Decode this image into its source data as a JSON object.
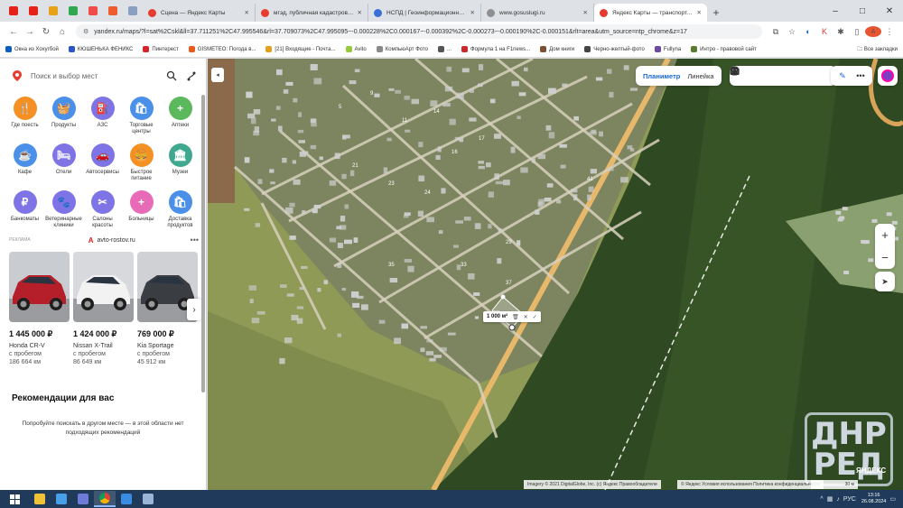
{
  "browser": {
    "pinned_tabs": [
      {
        "icon": "youtube-icon",
        "color": "#e62117"
      },
      {
        "icon": "youtube-icon",
        "color": "#e62117"
      },
      {
        "icon": "gmail-icon",
        "color": "#e6a117"
      },
      {
        "icon": "paw-icon",
        "color": "#2fa84f"
      },
      {
        "icon": "mail-icon",
        "color": "#f04a4a"
      },
      {
        "icon": "bookmark-icon",
        "color": "#ef5a2e"
      },
      {
        "icon": "page-icon",
        "color": "#8aa0c0"
      }
    ],
    "tabs": [
      {
        "title": "Сцена — Яндекс Карты",
        "color": "#e63b2e"
      },
      {
        "title": "мгэд, публичная кадастровая карта",
        "color": "#e63b2e"
      },
      {
        "title": "НСПД | Геоинформационный портал",
        "color": "#3b6fd8"
      },
      {
        "title": "www.gosuslugi.ru",
        "color": "#8f8f8f"
      },
      {
        "title": "Яндекс Карты — транспорт, навигация",
        "color": "#e63b2e",
        "active": true
      }
    ],
    "new_tab": "+",
    "window_controls": [
      "–",
      "□",
      "✕"
    ],
    "nav": {
      "back": "←",
      "forward": "→",
      "reload": "↻",
      "home": "⌂"
    },
    "url": "yandex.ru/maps/?l=sat%2Cskl&ll=37.711251%2C47.995546&rl=37.709073%2C47.995095~-0.000228%2C0.000167~-0.000392%2C-0.000273~-0.000190%2C-0.000151&rlt=area&utm_source=ntp_chrome&z=17",
    "bookmarks": [
      {
        "label": "Окна из Хохугбой",
        "color": "#0a5fbf"
      },
      {
        "label": "КЮШЕНЬКА ФЕНИКС",
        "color": "#2c56c6"
      },
      {
        "label": "Пинтерест",
        "color": "#d8232a"
      },
      {
        "label": "GISMETEO: Погода в...",
        "color": "#e85b1a"
      },
      {
        "label": "[21] Входящие - Почта...",
        "color": "#e0a11f"
      },
      {
        "label": "Avito",
        "color": "#96c93d"
      },
      {
        "label": "КомпьюАрт Фото",
        "color": "#8a8a8a"
      },
      {
        "label": "...",
        "color": "#555555"
      },
      {
        "label": "Формула 1 на F1news...",
        "color": "#cc2a2a"
      },
      {
        "label": "Дом книги",
        "color": "#7a5233"
      },
      {
        "label": "Черно-желтый-фото",
        "color": "#444444"
      },
      {
        "label": "Fullyna",
        "color": "#6b4aa3"
      },
      {
        "label": "Интро - правовой сайт",
        "color": "#5a7b2f"
      }
    ],
    "bookmarks_all": "Все закладки",
    "profile_letter": "А"
  },
  "sidebar": {
    "search_placeholder": "Поиск и выбор мест",
    "categories": [
      {
        "label": "Где поесть",
        "color": "#f59124",
        "icon": "fork-knife-icon",
        "glyph": "🍴"
      },
      {
        "label": "Продукты",
        "color": "#4a8fe8",
        "icon": "basket-icon",
        "glyph": "🧺"
      },
      {
        "label": "АЗС",
        "color": "#7e74e6",
        "icon": "fuel-icon",
        "glyph": "⛽"
      },
      {
        "label": "Торговые центры",
        "color": "#4a8fe8",
        "icon": "shopping-bag-icon",
        "glyph": "🛍"
      },
      {
        "label": "Аптеки",
        "color": "#5cb85c",
        "icon": "pharmacy-cross-icon",
        "glyph": "+"
      },
      {
        "label": "Кафе",
        "color": "#4a8fe8",
        "icon": "coffee-cup-icon",
        "glyph": "☕"
      },
      {
        "label": "Отели",
        "color": "#7e74e6",
        "icon": "bed-icon",
        "glyph": "🛏"
      },
      {
        "label": "Автосервисы",
        "color": "#7e74e6",
        "icon": "car-service-icon",
        "glyph": "🚗"
      },
      {
        "label": "Быстрое питание",
        "color": "#f59124",
        "icon": "burger-icon",
        "glyph": "🍔"
      },
      {
        "label": "Музеи",
        "color": "#3fa88f",
        "icon": "museum-icon",
        "glyph": "🏛"
      },
      {
        "label": "Банкоматы",
        "color": "#7e74e6",
        "icon": "ruble-icon",
        "glyph": "₽"
      },
      {
        "label": "Ветеринарные клиники",
        "color": "#7e74e6",
        "icon": "paw-icon",
        "glyph": "🐾"
      },
      {
        "label": "Салоны красоты",
        "color": "#7e74e6",
        "icon": "scissors-icon",
        "glyph": "✂"
      },
      {
        "label": "Больницы",
        "color": "#e86bb7",
        "icon": "hospital-cross-icon",
        "glyph": "+"
      },
      {
        "label": "Доставка продуктов",
        "color": "#4a8fe8",
        "icon": "delivery-bag-icon",
        "glyph": "🛍"
      }
    ],
    "ad": {
      "label": "РЕКЛАМА",
      "source": "avto-rostov.ru",
      "more": "•••",
      "next": "›",
      "cars": [
        {
          "price": "1 445 000 ₽",
          "model": "Honda CR-V",
          "note1": "с пробегом",
          "note2": "186 664 км",
          "body": "#b51f2a",
          "bg": "#c9ccd1"
        },
        {
          "price": "1 424 000 ₽",
          "model": "Nissan X-Trail",
          "note1": "с пробегом",
          "note2": "86 649 км",
          "body": "#f2f2f2",
          "bg": "#d7d9dd"
        },
        {
          "price": "769 000 ₽",
          "model": "Kia Sportage",
          "note1": "с пробегом",
          "note2": "45 912 км",
          "body": "#3a3d42",
          "bg": "#cfd1d5"
        }
      ]
    },
    "recommendations_title": "Рекомендации для вас",
    "recommendations_text": "Попробуйте поискать в другом месте — в этой области нет подходящих рекомендаций"
  },
  "map": {
    "collapse": "◂",
    "mode_plan": "Планиметр",
    "mode_ruler": "Линейка",
    "area_value": "1 000 м²",
    "area_actions": [
      "🗑",
      "✕",
      "✓"
    ],
    "zoom_in": "+",
    "zoom_out": "−",
    "locate": "➤",
    "tools": [
      "✎",
      "•••"
    ],
    "copyright": "Imagery © 2021 DigitalGlobe, Inc. (c) Яндекс   Правообладатели",
    "terms": "© Яндекс  Условия использования  Политика конфиденциальности",
    "scale": "30 м",
    "watermark_line1": "ДНР",
    "watermark_line2": "РЕД",
    "watermark_brand": "ЯНДЕКС",
    "house_numbers": [
      "5",
      "9",
      "11",
      "14",
      "16",
      "17",
      "21",
      "23",
      "24",
      "29",
      "33",
      "35",
      "37",
      "41"
    ],
    "colors": {
      "field": "#8f9a57",
      "field_dark": "#6f7d45",
      "forest": "#2f4a22",
      "forest_light": "#3e5c2b",
      "road": "#d7d0bd",
      "highway": "#e8b86a",
      "village": "#7d8560",
      "roof": "#cfcfcf",
      "water": "#d9a35a"
    }
  },
  "taskbar": {
    "apps": [
      {
        "icon": "file-explorer-icon",
        "color": "#f0c23a"
      },
      {
        "icon": "media-player-icon",
        "color": "#4aa0e8"
      },
      {
        "icon": "disk-save-icon",
        "color": "#6f7bd8"
      },
      {
        "icon": "chrome-icon",
        "color": "#e2a23a",
        "active": true
      },
      {
        "icon": "app-icon",
        "color": "#3a8be2"
      },
      {
        "icon": "screen-icon",
        "color": "#9ab4d8"
      }
    ],
    "language": "РУС",
    "time": "13:16",
    "date": "26.08.2024"
  }
}
